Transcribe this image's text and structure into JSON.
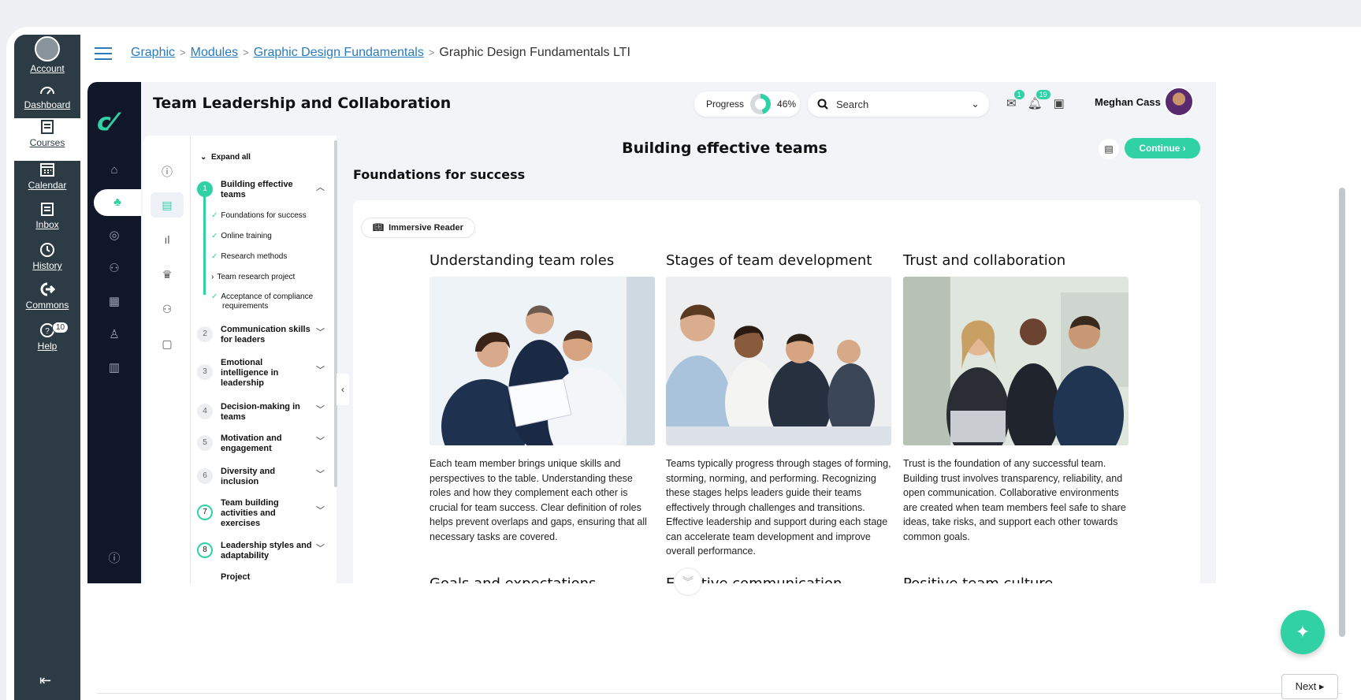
{
  "canvas_nav": {
    "items": [
      {
        "label": "Account"
      },
      {
        "label": "Dashboard"
      },
      {
        "label": "Courses"
      },
      {
        "label": "Calendar"
      },
      {
        "label": "Inbox"
      },
      {
        "label": "History"
      },
      {
        "label": "Commons"
      },
      {
        "label": "Help",
        "badge": "10"
      }
    ]
  },
  "breadcrumb": {
    "items": [
      "Graphic",
      "Modules",
      "Graphic Design Fundamentals"
    ],
    "current": "Graphic Design Fundamentals LTI"
  },
  "app": {
    "title": "Team Leadership and Collaboration",
    "progress_label": "Progress",
    "progress_value": "46%",
    "progress_fraction": 0.46,
    "search_placeholder": "Search",
    "inbox_badge": "1",
    "notif_badge": "19",
    "user_name": "Meghan Cass"
  },
  "tree": {
    "expand_all": "Expand all",
    "modules": [
      {
        "num": "1",
        "label": "Building effective teams",
        "expanded": true
      },
      {
        "num": "2",
        "label": "Communication skills for leaders"
      },
      {
        "num": "3",
        "label": "Emotional intelligence in leadership"
      },
      {
        "num": "4",
        "label": "Decision-making in teams"
      },
      {
        "num": "5",
        "label": "Motivation and engagement"
      },
      {
        "num": "6",
        "label": "Diversity and inclusion"
      },
      {
        "num": "7",
        "label": "Team building activities and exercises"
      },
      {
        "num": "8",
        "label": "Leadership styles and adaptability"
      },
      {
        "num": "",
        "label": "Project"
      }
    ],
    "subitems": [
      "Foundations for success",
      "Online training",
      "Research methods",
      "Team research project",
      "Acceptance of compliance requirements"
    ]
  },
  "content": {
    "heading": "Building effective teams",
    "continue_label": "Continue",
    "section_title": "Foundations for success",
    "immersive_reader": "Immersive Reader",
    "columns": [
      {
        "title": "Understanding team roles",
        "text": "Each team member brings unique skills and perspectives to the table. Understanding these roles and how they complement each other is crucial for team success. Clear definition of roles helps prevent overlaps and gaps, ensuring that all necessary tasks are covered."
      },
      {
        "title": "Stages of team development",
        "text": "Teams typically progress through stages of forming, storming, norming, and performing. Recognizing these stages helps leaders guide their teams effectively through challenges and transitions. Effective leadership and support during each stage can accelerate team development and improve overall performance."
      },
      {
        "title": "Trust and collaboration",
        "text": "Trust is the foundation of any successful team. Building trust involves transparency, reliability, and open communication. Collaborative environments are created when team members feel safe to share ideas, take risks, and support each other towards common goals."
      }
    ],
    "next_headings": [
      "Goals and expectations",
      "Effective communication",
      "Positive team culture"
    ]
  },
  "footer": {
    "next_label": "Next ▸"
  },
  "colors": {
    "accent": "#2fd1a5",
    "canvas_nav": "#2d3b45",
    "rail": "#0f1729",
    "link": "#2b7abc"
  }
}
